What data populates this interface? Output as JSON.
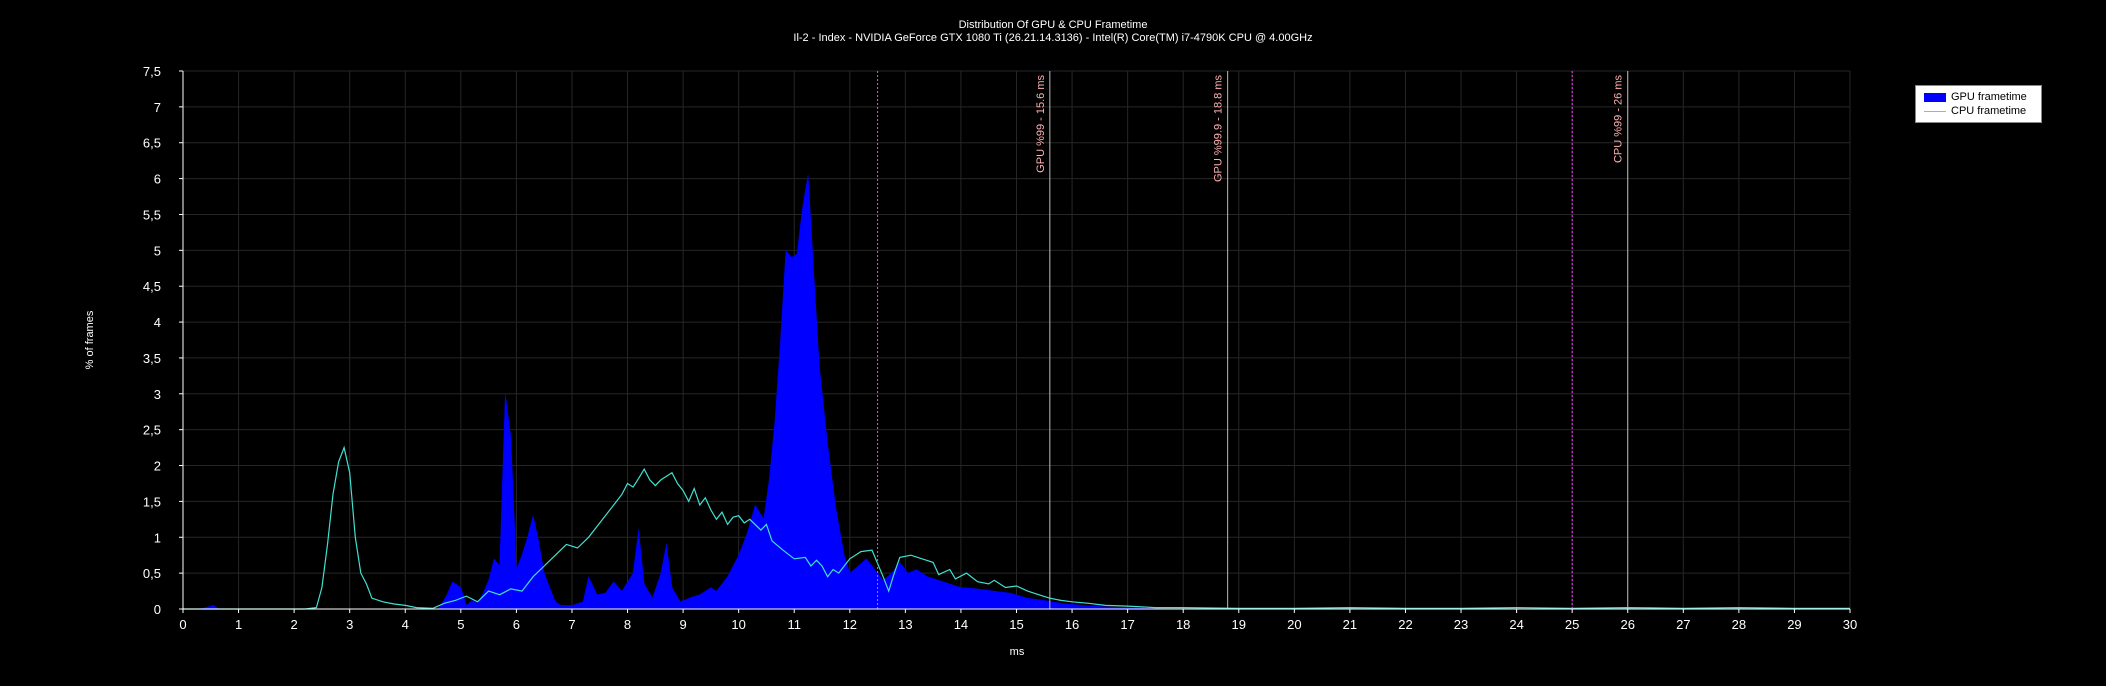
{
  "chart_data": {
    "type": "area",
    "title": "Distribution Of GPU & CPU Frametime",
    "subtitle": "Il-2 - Index - NVIDIA GeForce GTX 1080 Ti (26.21.14.3136) - Intel(R) Core(TM) i7-4790K CPU @ 4.00GHz",
    "xlabel": "ms",
    "ylabel": "% of frames",
    "xlim": [
      0,
      30
    ],
    "ylim": [
      0,
      7.5
    ],
    "x_ticks": [
      "0",
      "1",
      "2",
      "3",
      "4",
      "5",
      "6",
      "7",
      "8",
      "9",
      "10",
      "11",
      "12",
      "13",
      "14",
      "15",
      "16",
      "17",
      "18",
      "19",
      "20",
      "21",
      "22",
      "23",
      "24",
      "25",
      "26",
      "27",
      "28",
      "29",
      "30"
    ],
    "y_ticks": [
      "0",
      "0,5",
      "1",
      "1,5",
      "2",
      "2,5",
      "3",
      "3,5",
      "4",
      "4,5",
      "5",
      "5,5",
      "6",
      "6,5",
      "7",
      "7,5"
    ],
    "grid": true,
    "legend_position": "top-right",
    "series": [
      {
        "name": "GPU frametime",
        "kind": "area",
        "color": "#0000ff",
        "points": [
          [
            0.3,
            0
          ],
          [
            0.45,
            0.03
          ],
          [
            0.55,
            0.05
          ],
          [
            0.65,
            0
          ],
          [
            4.6,
            0
          ],
          [
            4.75,
            0.2
          ],
          [
            4.85,
            0.38
          ],
          [
            5.0,
            0.3
          ],
          [
            5.1,
            0.05
          ],
          [
            5.2,
            0.12
          ],
          [
            5.3,
            0.08
          ],
          [
            5.4,
            0.22
          ],
          [
            5.5,
            0.4
          ],
          [
            5.6,
            0.7
          ],
          [
            5.7,
            0.6
          ],
          [
            5.8,
            3.0
          ],
          [
            5.9,
            2.4
          ],
          [
            6.0,
            0.55
          ],
          [
            6.1,
            0.75
          ],
          [
            6.2,
            1.0
          ],
          [
            6.3,
            1.3
          ],
          [
            6.4,
            0.95
          ],
          [
            6.5,
            0.5
          ],
          [
            6.6,
            0.3
          ],
          [
            6.7,
            0.1
          ],
          [
            6.8,
            0.05
          ],
          [
            7.0,
            0.05
          ],
          [
            7.2,
            0.1
          ],
          [
            7.3,
            0.45
          ],
          [
            7.45,
            0.2
          ],
          [
            7.6,
            0.22
          ],
          [
            7.75,
            0.38
          ],
          [
            7.9,
            0.25
          ],
          [
            8.1,
            0.5
          ],
          [
            8.2,
            1.1
          ],
          [
            8.3,
            0.35
          ],
          [
            8.45,
            0.15
          ],
          [
            8.6,
            0.5
          ],
          [
            8.7,
            0.9
          ],
          [
            8.8,
            0.3
          ],
          [
            8.95,
            0.1
          ],
          [
            9.1,
            0.15
          ],
          [
            9.3,
            0.2
          ],
          [
            9.5,
            0.3
          ],
          [
            9.6,
            0.25
          ],
          [
            9.8,
            0.45
          ],
          [
            10.0,
            0.75
          ],
          [
            10.15,
            1.05
          ],
          [
            10.3,
            1.45
          ],
          [
            10.45,
            1.25
          ],
          [
            10.55,
            1.8
          ],
          [
            10.65,
            2.6
          ],
          [
            10.75,
            3.7
          ],
          [
            10.85,
            5.0
          ],
          [
            10.95,
            4.9
          ],
          [
            11.05,
            4.95
          ],
          [
            11.15,
            5.6
          ],
          [
            11.25,
            6.05
          ],
          [
            11.35,
            4.7
          ],
          [
            11.45,
            3.4
          ],
          [
            11.6,
            2.3
          ],
          [
            11.75,
            1.4
          ],
          [
            11.9,
            0.75
          ],
          [
            12.0,
            0.5
          ],
          [
            12.15,
            0.6
          ],
          [
            12.3,
            0.7
          ],
          [
            12.45,
            0.55
          ],
          [
            12.6,
            0.4
          ],
          [
            12.75,
            0.5
          ],
          [
            12.9,
            0.65
          ],
          [
            13.05,
            0.5
          ],
          [
            13.2,
            0.55
          ],
          [
            13.4,
            0.45
          ],
          [
            13.6,
            0.4
          ],
          [
            13.8,
            0.35
          ],
          [
            14.0,
            0.3
          ],
          [
            14.3,
            0.28
          ],
          [
            14.6,
            0.25
          ],
          [
            14.9,
            0.22
          ],
          [
            15.2,
            0.15
          ],
          [
            15.5,
            0.12
          ],
          [
            15.8,
            0.08
          ],
          [
            16.2,
            0.05
          ],
          [
            16.6,
            0.03
          ],
          [
            17.2,
            0.01
          ],
          [
            18.0,
            0
          ]
        ]
      },
      {
        "name": "CPU frametime",
        "kind": "line",
        "color": "#40e0d0",
        "points": [
          [
            0,
            0
          ],
          [
            2.2,
            0
          ],
          [
            2.4,
            0.02
          ],
          [
            2.5,
            0.3
          ],
          [
            2.6,
            0.9
          ],
          [
            2.7,
            1.6
          ],
          [
            2.8,
            2.05
          ],
          [
            2.9,
            2.25
          ],
          [
            3.0,
            1.9
          ],
          [
            3.1,
            1.0
          ],
          [
            3.2,
            0.5
          ],
          [
            3.3,
            0.35
          ],
          [
            3.4,
            0.15
          ],
          [
            3.6,
            0.1
          ],
          [
            3.8,
            0.07
          ],
          [
            4.0,
            0.05
          ],
          [
            4.2,
            0.02
          ],
          [
            4.5,
            0.01
          ],
          [
            4.7,
            0.08
          ],
          [
            4.9,
            0.12
          ],
          [
            5.1,
            0.18
          ],
          [
            5.3,
            0.1
          ],
          [
            5.5,
            0.25
          ],
          [
            5.7,
            0.2
          ],
          [
            5.9,
            0.28
          ],
          [
            6.1,
            0.25
          ],
          [
            6.3,
            0.45
          ],
          [
            6.5,
            0.6
          ],
          [
            6.7,
            0.75
          ],
          [
            6.9,
            0.9
          ],
          [
            7.1,
            0.85
          ],
          [
            7.3,
            1.0
          ],
          [
            7.5,
            1.2
          ],
          [
            7.7,
            1.4
          ],
          [
            7.9,
            1.6
          ],
          [
            8.0,
            1.75
          ],
          [
            8.1,
            1.7
          ],
          [
            8.2,
            1.82
          ],
          [
            8.3,
            1.95
          ],
          [
            8.4,
            1.8
          ],
          [
            8.5,
            1.72
          ],
          [
            8.6,
            1.8
          ],
          [
            8.7,
            1.85
          ],
          [
            8.8,
            1.9
          ],
          [
            8.9,
            1.75
          ],
          [
            9.0,
            1.65
          ],
          [
            9.1,
            1.5
          ],
          [
            9.2,
            1.68
          ],
          [
            9.3,
            1.45
          ],
          [
            9.4,
            1.55
          ],
          [
            9.5,
            1.38
          ],
          [
            9.6,
            1.25
          ],
          [
            9.7,
            1.35
          ],
          [
            9.8,
            1.18
          ],
          [
            9.9,
            1.28
          ],
          [
            10.0,
            1.3
          ],
          [
            10.1,
            1.2
          ],
          [
            10.2,
            1.25
          ],
          [
            10.4,
            1.1
          ],
          [
            10.5,
            1.18
          ],
          [
            10.6,
            0.95
          ],
          [
            10.8,
            0.82
          ],
          [
            11.0,
            0.7
          ],
          [
            11.2,
            0.72
          ],
          [
            11.3,
            0.6
          ],
          [
            11.4,
            0.68
          ],
          [
            11.5,
            0.6
          ],
          [
            11.6,
            0.45
          ],
          [
            11.7,
            0.55
          ],
          [
            11.8,
            0.5
          ],
          [
            11.9,
            0.6
          ],
          [
            12.0,
            0.7
          ],
          [
            12.2,
            0.8
          ],
          [
            12.4,
            0.82
          ],
          [
            12.6,
            0.45
          ],
          [
            12.7,
            0.25
          ],
          [
            12.8,
            0.5
          ],
          [
            12.9,
            0.72
          ],
          [
            13.1,
            0.75
          ],
          [
            13.3,
            0.7
          ],
          [
            13.5,
            0.65
          ],
          [
            13.6,
            0.48
          ],
          [
            13.8,
            0.55
          ],
          [
            13.9,
            0.42
          ],
          [
            14.1,
            0.5
          ],
          [
            14.3,
            0.38
          ],
          [
            14.5,
            0.35
          ],
          [
            14.6,
            0.4
          ],
          [
            14.8,
            0.3
          ],
          [
            15.0,
            0.32
          ],
          [
            15.2,
            0.25
          ],
          [
            15.4,
            0.2
          ],
          [
            15.6,
            0.15
          ],
          [
            15.8,
            0.12
          ],
          [
            16.0,
            0.1
          ],
          [
            16.3,
            0.08
          ],
          [
            16.6,
            0.05
          ],
          [
            17.0,
            0.04
          ],
          [
            17.5,
            0.02
          ],
          [
            18.0,
            0.02
          ],
          [
            19.0,
            0.01
          ],
          [
            20.0,
            0.01
          ],
          [
            21.0,
            0.02
          ],
          [
            22.0,
            0.01
          ],
          [
            23.0,
            0.01
          ],
          [
            24.0,
            0.02
          ],
          [
            25.0,
            0.01
          ],
          [
            26.0,
            0.02
          ],
          [
            27.0,
            0.01
          ],
          [
            28.0,
            0.02
          ],
          [
            29.0,
            0.01
          ],
          [
            30.0,
            0.01
          ]
        ]
      }
    ],
    "markers": [
      {
        "x": 12.5,
        "style": "dotted",
        "color": "#ff40ff",
        "label": ""
      },
      {
        "x": 15.6,
        "style": "solid",
        "color": "#bbbbbb",
        "label": "GPU %99 - 15.6 ms"
      },
      {
        "x": 18.8,
        "style": "solid",
        "color": "#bbbbbb",
        "label": "GPU %99.9 - 18.8 ms"
      },
      {
        "x": 25.0,
        "style": "dotted",
        "color": "#ff40ff",
        "label": ""
      },
      {
        "x": 26.0,
        "style": "solid",
        "color": "#bbbbbb",
        "label": "CPU %99 - 26 ms"
      }
    ]
  },
  "colors": {
    "background": "#000000",
    "text": "#ffffff",
    "grid": "#262626",
    "axis": "#ffffff",
    "marker_label": "#ffb0b0"
  }
}
